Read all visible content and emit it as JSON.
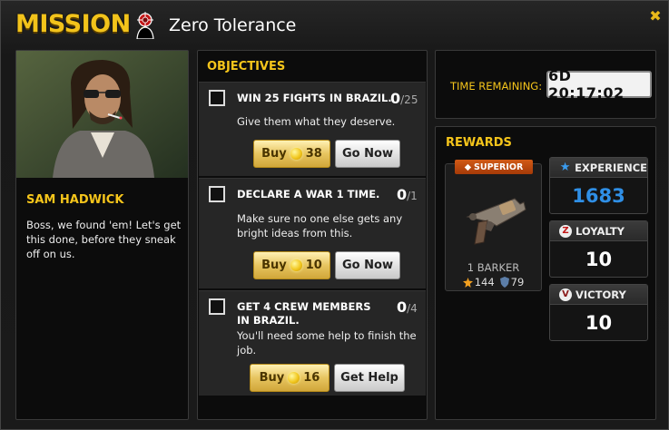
{
  "header": {
    "mission_label": "MISSION :",
    "mission_name": "Zero Tolerance",
    "close_icon": "close-x-icon"
  },
  "character": {
    "name": "SAM HADWICK",
    "dialogue": "Boss, we found 'em! Let's get this done, before they sneak off on us."
  },
  "objectives": {
    "title": "OBJECTIVES",
    "items": [
      {
        "name": "WIN 25 FIGHTS IN BRAZIL.",
        "progress": "0",
        "total": "/25",
        "desc": "Give them what they deserve.",
        "buy_label": "Buy",
        "cost": "38",
        "action_label": "Go Now"
      },
      {
        "name": "DECLARE A WAR 1 TIME.",
        "progress": "0",
        "total": "/1",
        "desc": "Make sure no one else gets any bright ideas from this.",
        "buy_label": "Buy",
        "cost": "10",
        "action_label": "Go Now"
      },
      {
        "name": "GET 4 CREW MEMBERS IN BRAZIL.",
        "progress": "0",
        "total": "/4",
        "desc": "You'll need some help to finish the job.",
        "buy_label": "Buy",
        "cost": "16",
        "action_label": "Get Help"
      }
    ]
  },
  "time": {
    "label": "TIME REMAINING:",
    "value": "6D 20:17:02"
  },
  "rewards": {
    "title": "REWARDS",
    "item": {
      "rarity": "SUPERIOR",
      "name": "1 BARKER",
      "attack": "144",
      "defense": "79"
    },
    "experience": {
      "label": "EXPERIENCE",
      "value": "1683",
      "color": "#2f8fe6"
    },
    "loyalty": {
      "label": "LOYALTY",
      "value": "10",
      "color": "#ffffff"
    },
    "victory": {
      "label": "VICTORY",
      "value": "10",
      "color": "#ffffff"
    }
  },
  "colors": {
    "accent": "#f5c51b",
    "rarity": "#d15a16"
  }
}
